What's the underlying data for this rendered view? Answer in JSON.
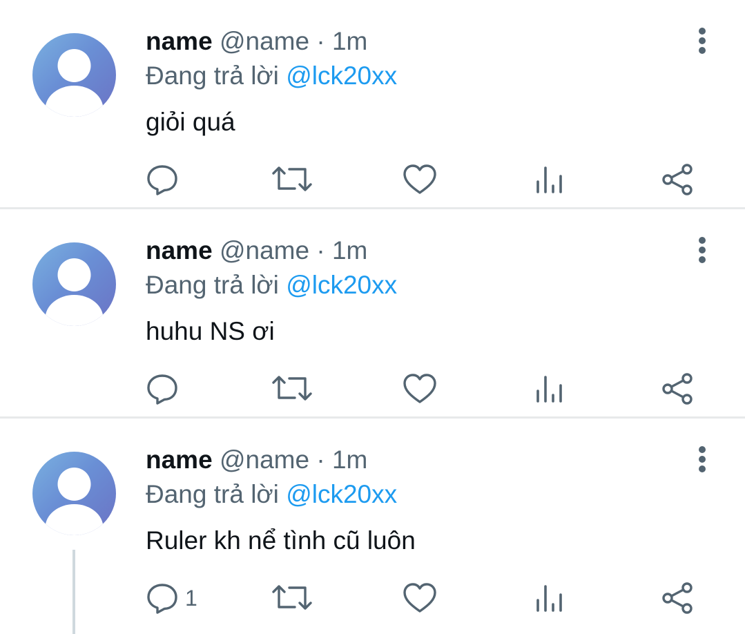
{
  "tweets": [
    {
      "name": "name",
      "handle": "@name",
      "separator": "·",
      "time": "1m",
      "reply_prefix": "Đang trả lời",
      "reply_to": "@lck20xx",
      "text": "giỏi quá",
      "reply_count": ""
    },
    {
      "name": "name",
      "handle": "@name",
      "separator": "·",
      "time": "1m",
      "reply_prefix": "Đang trả lời",
      "reply_to": "@lck20xx",
      "text": "huhu NS ơi",
      "reply_count": ""
    },
    {
      "name": "name",
      "handle": "@name",
      "separator": "·",
      "time": "1m",
      "reply_prefix": "Đang trả lời",
      "reply_to": "@lck20xx",
      "text": "Ruler kh nể tình cũ luôn",
      "reply_count": "1"
    }
  ],
  "icons": {
    "reply": "reply-icon",
    "retweet": "retweet-icon",
    "like": "heart-icon",
    "views": "views-icon",
    "share": "share-icon",
    "more": "more-vertical-icon",
    "avatar": "default-avatar-icon"
  },
  "colors": {
    "text": "#0f1419",
    "secondary": "#536471",
    "accent": "#1d9bf0",
    "divider": "#e7e9ea"
  }
}
